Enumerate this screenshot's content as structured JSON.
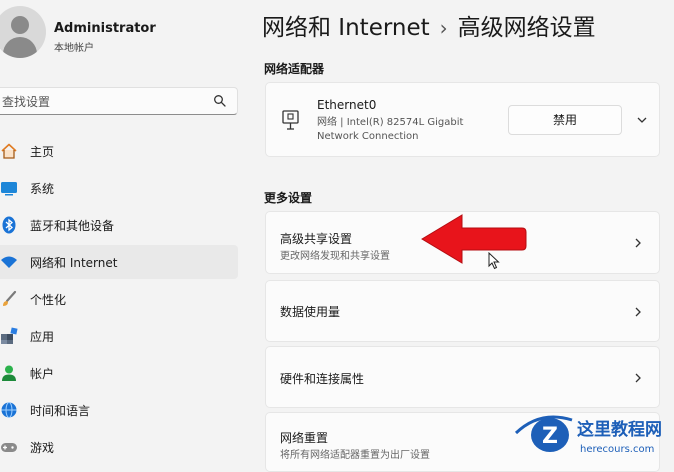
{
  "user": {
    "name": "Administrator",
    "account_type": "本地帐户"
  },
  "search": {
    "placeholder": "查找设置"
  },
  "nav": {
    "items": [
      {
        "label": "主页",
        "icon": "home-icon"
      },
      {
        "label": "系统",
        "icon": "system-icon"
      },
      {
        "label": "蓝牙和其他设备",
        "icon": "bluetooth-icon"
      },
      {
        "label": "网络和 Internet",
        "icon": "wifi-icon",
        "active": true
      },
      {
        "label": "个性化",
        "icon": "brush-icon"
      },
      {
        "label": "应用",
        "icon": "apps-icon"
      },
      {
        "label": "帐户",
        "icon": "account-icon"
      },
      {
        "label": "时间和语言",
        "icon": "globe-icon"
      },
      {
        "label": "游戏",
        "icon": "gamepad-icon"
      }
    ]
  },
  "breadcrumb": {
    "parent": "网络和 Internet",
    "separator": "›",
    "current": "高级网络设置"
  },
  "adapters": {
    "title": "网络适配器",
    "adapter": {
      "name": "Ethernet0",
      "description": "网络 | Intel(R) 82574L Gigabit Network Connection",
      "button": "禁用"
    }
  },
  "more_settings": {
    "title": "更多设置",
    "items": [
      {
        "title": "高级共享设置",
        "subtitle": "更改网络发现和共享设置"
      },
      {
        "title": "数据使用量",
        "subtitle": ""
      },
      {
        "title": "硬件和连接属性",
        "subtitle": ""
      },
      {
        "title": "网络重置",
        "subtitle": "将所有网络适配器重置为出厂设置"
      }
    ]
  },
  "watermark": {
    "text": "这里教程网",
    "domain": "herecours.com"
  },
  "colors": {
    "accent": "#0067c0",
    "annotation_arrow": "#e8141b"
  }
}
